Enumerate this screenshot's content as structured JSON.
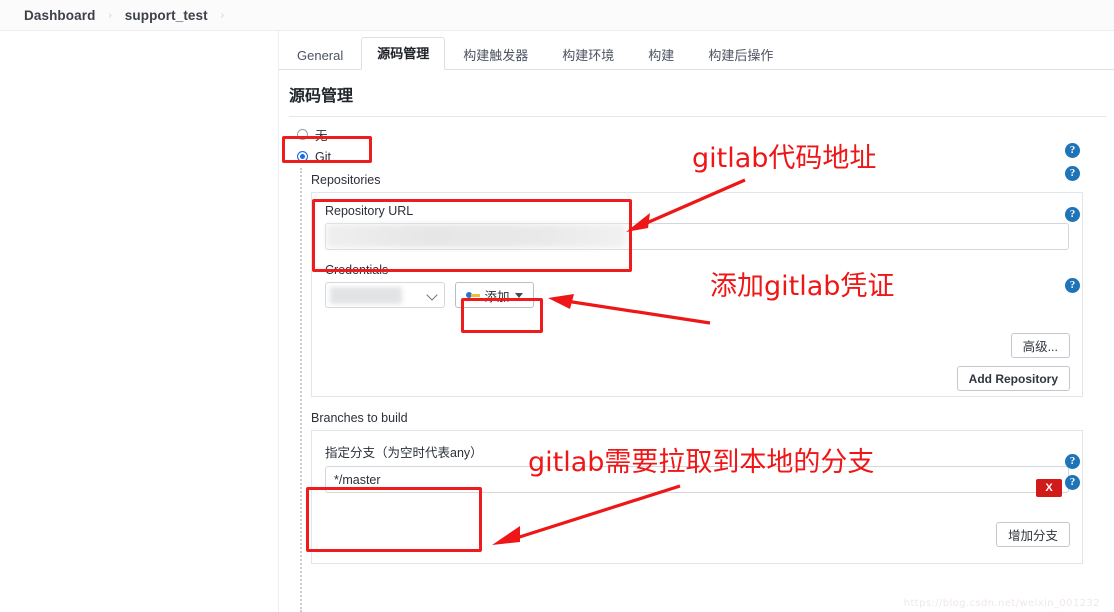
{
  "breadcrumb": {
    "items": [
      "Dashboard",
      "support_test"
    ],
    "separator": "›"
  },
  "tabs": [
    {
      "label": "General",
      "active": false
    },
    {
      "label": "源码管理",
      "active": true
    },
    {
      "label": "构建触发器",
      "active": false
    },
    {
      "label": "构建环境",
      "active": false
    },
    {
      "label": "构建",
      "active": false
    },
    {
      "label": "构建后操作",
      "active": false
    }
  ],
  "section": {
    "title": "源码管理",
    "scm_options": [
      {
        "label": "无",
        "selected": false
      },
      {
        "label": "Git",
        "selected": true
      }
    ]
  },
  "repositories": {
    "group_label": "Repositories",
    "url_label": "Repository URL",
    "url_value": "",
    "url_redacted": true,
    "credentials_label": "Credentials",
    "credentials_value": "",
    "credentials_redacted": true,
    "add_credentials_button": "添加",
    "add_credentials_icon": "key-icon",
    "advanced_button": "高级...",
    "add_repository_button": "Add Repository"
  },
  "branches": {
    "group_label": "Branches to build",
    "branch_label": "指定分支（为空时代表any）",
    "branch_value": "*/master",
    "delete_badge": "X",
    "add_branch_button": "增加分支"
  },
  "help_icon": "?",
  "annotations": [
    {
      "text": "gitlab代码地址",
      "id": "anno-repo-url"
    },
    {
      "text": "添加gitlab凭证",
      "id": "anno-credentials"
    },
    {
      "text": "gitlab需要拉取到本地的分支",
      "id": "anno-branches"
    }
  ],
  "colors": {
    "annotation_red": "#ee1616",
    "help_blue": "#1f73b7",
    "radio_blue": "#1a6ce7",
    "delete_red": "#d11a1a"
  },
  "watermark": "https://blog.csdn.net/weixin_001232"
}
